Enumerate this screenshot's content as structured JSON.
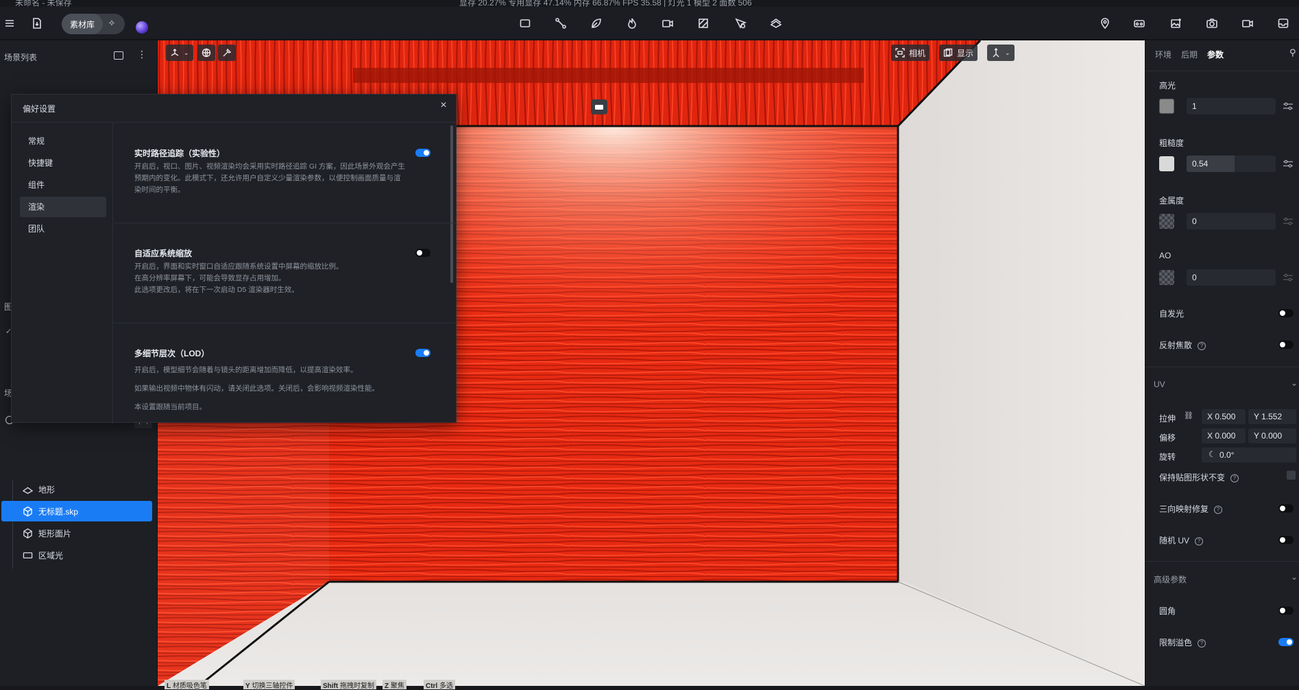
{
  "titlebar": {
    "title": "未命名 - 未保存",
    "stats": "显存 20.27%    专用显存 47.14%    内存 66.87%    FPS 35.58   |   灯光 1    模型 2    面数 506"
  },
  "toolbar": {
    "library_label": "素材库",
    "center_tools": [
      "rect-tool-icon",
      "path-tool-icon",
      "leaf-tool-icon",
      "fire-tool-icon",
      "video-tool-icon",
      "texture-tool-icon",
      "place-tool-icon",
      "terrain-tool-icon"
    ],
    "right_tools": [
      "pin-icon",
      "vr-icon",
      "image-edit-icon",
      "camera-icon",
      "video-icon",
      "inbox-icon"
    ]
  },
  "left_panel": {
    "header": "场景列表",
    "tree": [
      {
        "label": "地形",
        "icon": "terrain-icon",
        "selected": false
      },
      {
        "label": "无标题.skp",
        "icon": "model-icon",
        "selected": true
      },
      {
        "label": "矩形面片",
        "icon": "model-icon",
        "selected": false
      },
      {
        "label": "区域光",
        "icon": "area-light-icon",
        "selected": false
      }
    ],
    "partial_labels": [
      "图",
      "场"
    ]
  },
  "viewport": {
    "camera_label": "相机",
    "display_label": "显示",
    "hints": [
      {
        "key": "L",
        "text": "材质吸色笔"
      },
      {
        "key": "Y",
        "text": "切换三轴控件"
      },
      {
        "key": "Shift",
        "text": "拖拽时复制"
      },
      {
        "key": "Z",
        "text": "聚焦"
      },
      {
        "key": "Ctrl",
        "text": "多选"
      }
    ]
  },
  "dialog": {
    "title": "偏好设置",
    "nav": [
      "常规",
      "快捷键",
      "组件",
      "渲染",
      "团队"
    ],
    "active_nav": "渲染",
    "settings": [
      {
        "title": "实时路径追踪（实验性）",
        "on": true,
        "desc": [
          "开启后，视口、图片、视频渲染均会采用实时路径追踪 GI 方案，因此场景外观会产生",
          "预期内的变化。此模式下，还允许用户自定义少量渲染参数，以便控制画面质量与渲",
          "染时间的平衡。"
        ]
      },
      {
        "title": "自适应系统缩放",
        "on": false,
        "desc": [
          "开启后，界面和实时窗口自适应跟随系统设置中屏幕的缩放比例。",
          "在高分辨率屏幕下，可能会导致显存占用增加。",
          "此选项更改后，将在下一次启动 D5 渲染器时生效。"
        ]
      },
      {
        "title": "多细节层次（LOD）",
        "on": true,
        "desc": [
          "开启后，模型细节会随着与镜头的距离增加而降低，以提高渲染效率。",
          "如果输出视频中物体有闪动，请关闭此选项。关闭后，会影响视频渲染性能。",
          "本设置跟随当前项目。"
        ]
      }
    ]
  },
  "right_panel": {
    "tabs": [
      "环境",
      "后期",
      "参数"
    ],
    "active_tab": "参数",
    "specular": {
      "label": "高光",
      "value": "1"
    },
    "roughness": {
      "label": "粗糙度",
      "value": "0.54"
    },
    "metallic": {
      "label": "金属度",
      "value": "0"
    },
    "ao": {
      "label": "AO",
      "value": "0"
    },
    "emissive": {
      "label": "自发光",
      "on": false
    },
    "caustics": {
      "label": "反射焦散",
      "on": false
    },
    "uv": {
      "header": "UV",
      "stretch_label": "拉伸",
      "stretch_x": "X  0.500",
      "stretch_y": "Y  1.552",
      "offset_label": "偏移",
      "offset_x": "X  0.000",
      "offset_y": "Y  0.000",
      "rotate_label": "旋转",
      "rotate_value": "0.0°",
      "keep_shape_label": "保持贴图形状不变",
      "triplanar_label": "三向映射修复",
      "triplanar_on": false,
      "random_uv_label": "随机 UV",
      "random_uv_on": false
    },
    "advanced": {
      "header": "高级参数",
      "round_label": "圆角",
      "round_on": false,
      "clamp_label": "限制溢色",
      "clamp_on": true
    },
    "colors": {
      "accent": "#1a7cf5",
      "roughness_swatch": "#d9d9d9",
      "specular_swatch": "#8a8a8a"
    }
  }
}
